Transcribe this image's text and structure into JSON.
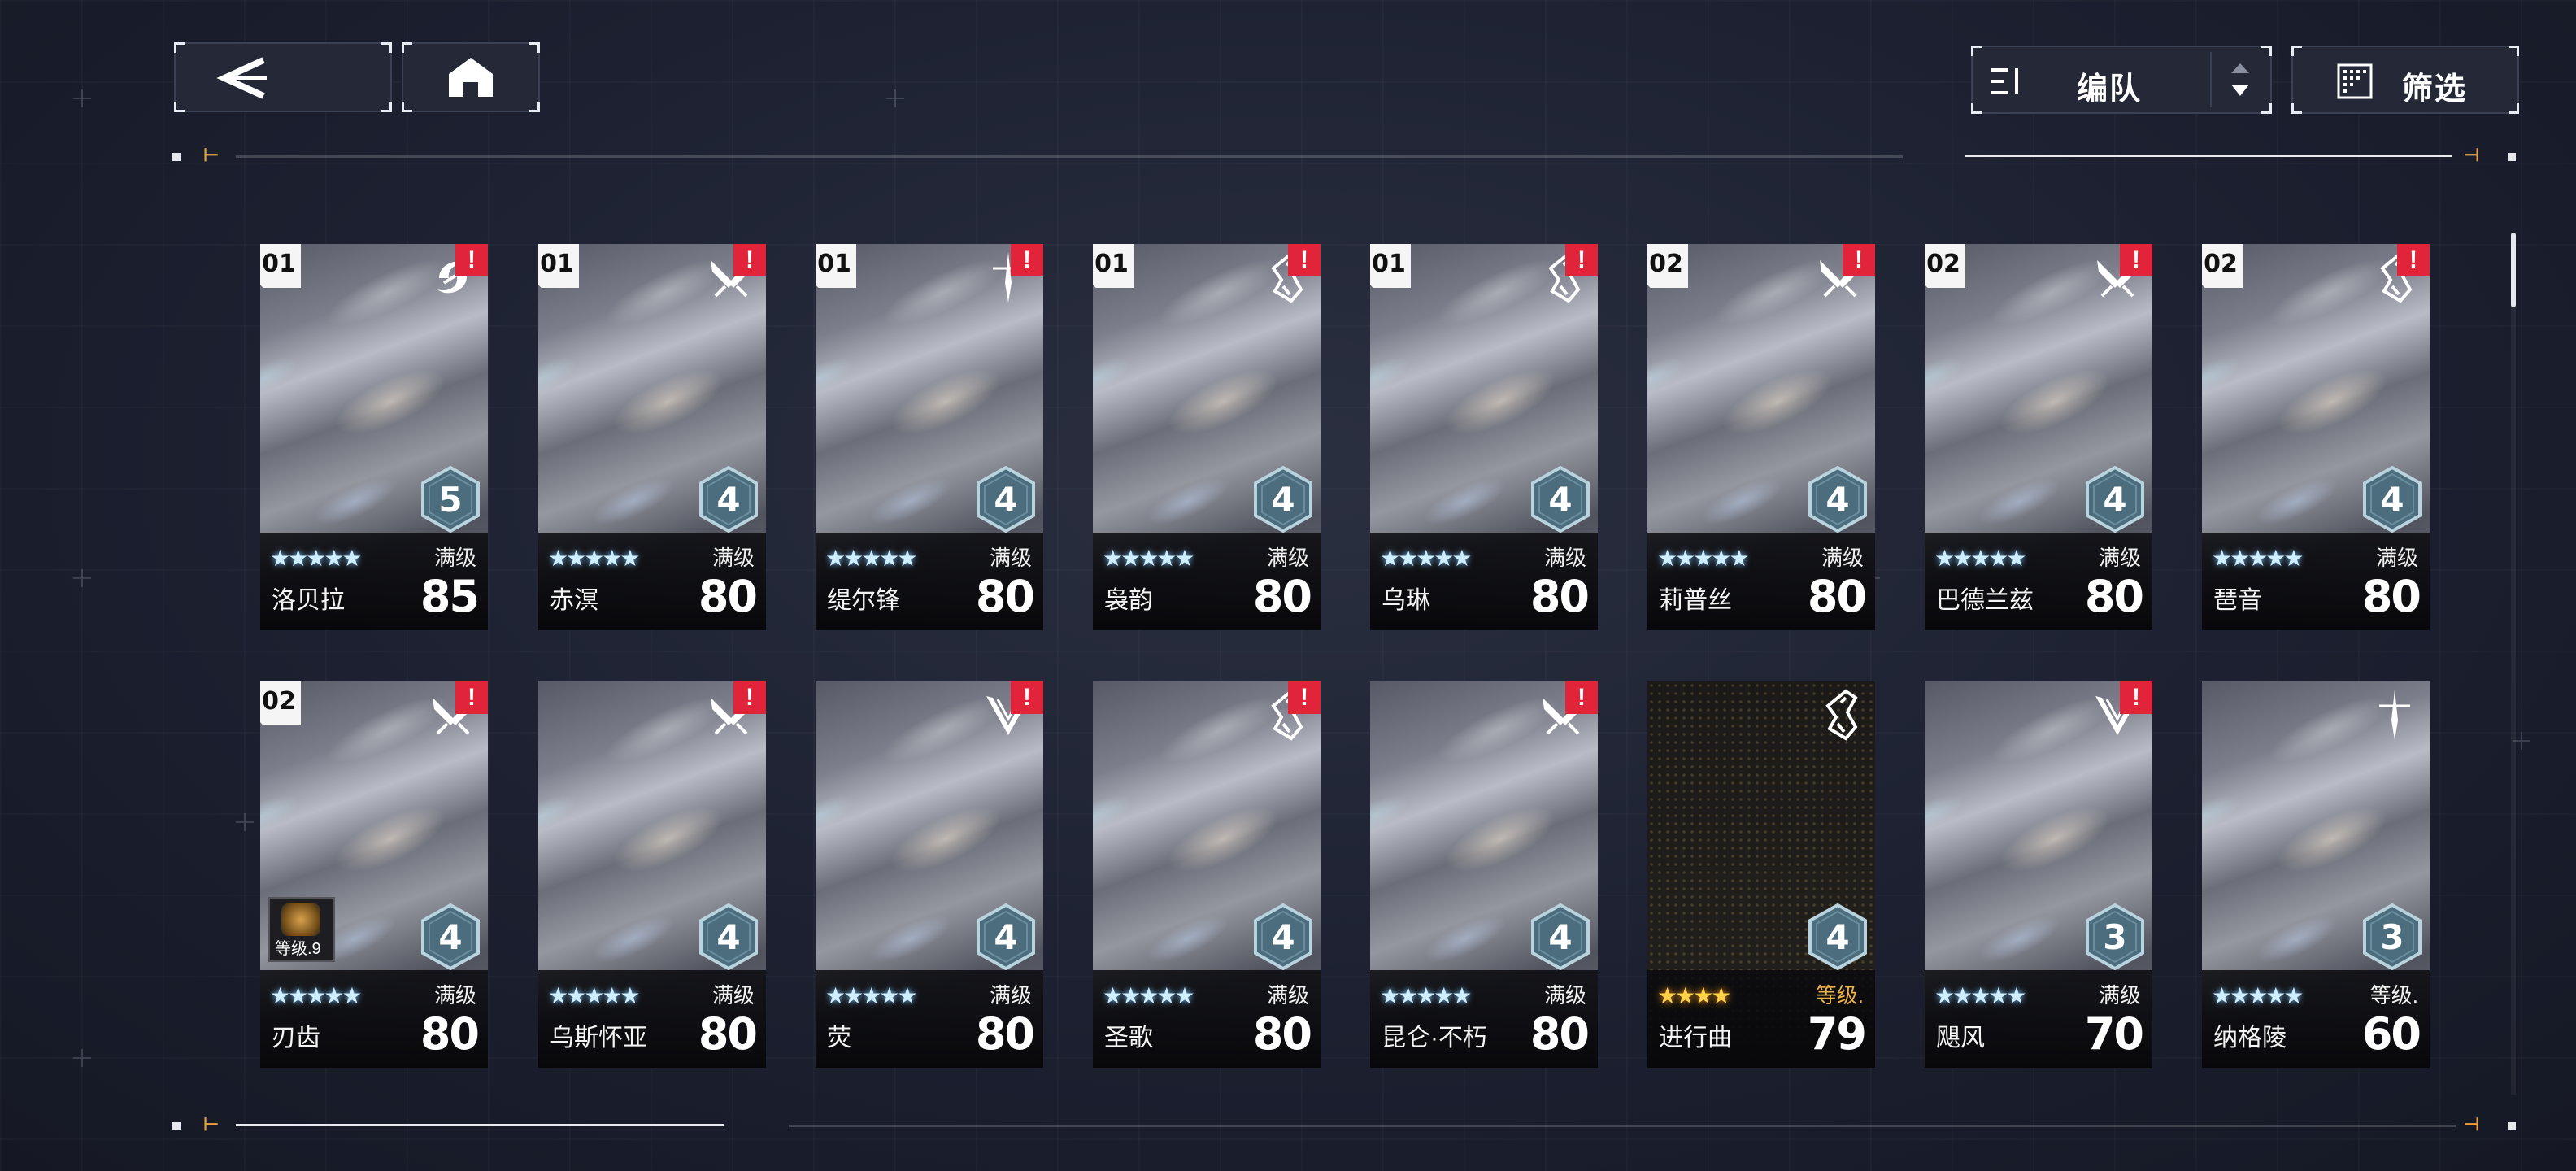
{
  "header": {
    "back_icon": "back-arrow-icon",
    "home_icon": "home-icon",
    "sort": {
      "label": "编队",
      "icon": "sort-list-icon",
      "toggle_icon": "sort-order-icon"
    },
    "filter": {
      "label": "筛选",
      "icon": "filter-grid-icon"
    }
  },
  "colors": {
    "alert": "#e2243a",
    "gold": "#ffd24a",
    "star_blue": "#cfeeff",
    "hex_fill": "#4b6d7d"
  },
  "cards": [
    {
      "team": "01",
      "name": "洛贝拉",
      "level_label": "满级",
      "level": "85",
      "rank": "5",
      "stars": "★★★★★",
      "class_icon": "swirl-class-icon",
      "alert": "!",
      "dark": false,
      "gold": false
    },
    {
      "team": "01",
      "name": "赤溟",
      "level_label": "满级",
      "level": "80",
      "rank": "4",
      "stars": "★★★★★",
      "class_icon": "cross-blades-class-icon",
      "alert": "!",
      "dark": false,
      "gold": false
    },
    {
      "team": "01",
      "name": "缇尔锋",
      "level_label": "满级",
      "level": "80",
      "rank": "4",
      "stars": "★★★★★",
      "class_icon": "sword-class-icon",
      "alert": "!",
      "dark": false,
      "gold": false
    },
    {
      "team": "01",
      "name": "袅韵",
      "level_label": "满级",
      "level": "80",
      "rank": "4",
      "stars": "★★★★★",
      "class_icon": "shield-class-icon",
      "alert": "!",
      "dark": false,
      "gold": false
    },
    {
      "team": "01",
      "name": "乌琳",
      "level_label": "满级",
      "level": "80",
      "rank": "4",
      "stars": "★★★★★",
      "class_icon": "shield-class-icon",
      "alert": "!",
      "dark": false,
      "gold": false
    },
    {
      "team": "02",
      "name": "莉普丝",
      "level_label": "满级",
      "level": "80",
      "rank": "4",
      "stars": "★★★★★",
      "class_icon": "cross-blades-class-icon",
      "alert": "!",
      "dark": false,
      "gold": false
    },
    {
      "team": "02",
      "name": "巴德兰兹",
      "level_label": "满级",
      "level": "80",
      "rank": "4",
      "stars": "★★★★★",
      "class_icon": "cross-blades-class-icon",
      "alert": "!",
      "dark": false,
      "gold": false
    },
    {
      "team": "02",
      "name": "琶音",
      "level_label": "满级",
      "level": "80",
      "rank": "4",
      "stars": "★★★★★",
      "class_icon": "shield-class-icon",
      "alert": "!",
      "dark": false,
      "gold": false
    },
    {
      "team": "02",
      "name": "刃齿",
      "level_label": "满级",
      "level": "80",
      "rank": "4",
      "stars": "★★★★★",
      "class_icon": "cross-blades-class-icon",
      "alert": "!",
      "dark": false,
      "gold": false,
      "weapon": {
        "label": "等级.9"
      }
    },
    {
      "team": "",
      "name": "乌斯怀亚",
      "level_label": "满级",
      "level": "80",
      "rank": "4",
      "stars": "★★★★★",
      "class_icon": "cross-blades-class-icon",
      "alert": "!",
      "dark": false,
      "gold": false
    },
    {
      "team": "",
      "name": "荧",
      "level_label": "满级",
      "level": "80",
      "rank": "4",
      "stars": "★★★★★",
      "class_icon": "wings-class-icon",
      "alert": "!",
      "dark": false,
      "gold": false
    },
    {
      "team": "",
      "name": "圣歌",
      "level_label": "满级",
      "level": "80",
      "rank": "4",
      "stars": "★★★★★",
      "class_icon": "shield-class-icon",
      "alert": "!",
      "dark": false,
      "gold": false
    },
    {
      "team": "",
      "name": "昆仑·不朽",
      "level_label": "满级",
      "level": "80",
      "rank": "4",
      "stars": "★★★★★",
      "class_icon": "cross-blades-class-icon",
      "alert": "!",
      "dark": false,
      "gold": false
    },
    {
      "team": "",
      "name": "进行曲",
      "level_label": "等级.",
      "level": "79",
      "rank": "4",
      "stars": "★★★★",
      "class_icon": "shield-class-icon",
      "alert": "",
      "dark": true,
      "gold": true
    },
    {
      "team": "",
      "name": "飓风",
      "level_label": "满级",
      "level": "70",
      "rank": "3",
      "stars": "★★★★★",
      "class_icon": "wings-class-icon",
      "alert": "!",
      "dark": false,
      "gold": false
    },
    {
      "team": "",
      "name": "纳格陵",
      "level_label": "等级.",
      "level": "60",
      "rank": "3",
      "stars": "★★★★★",
      "class_icon": "sword-class-icon",
      "alert": "",
      "dark": false,
      "gold": false
    }
  ],
  "scroll": {
    "position": 0
  }
}
